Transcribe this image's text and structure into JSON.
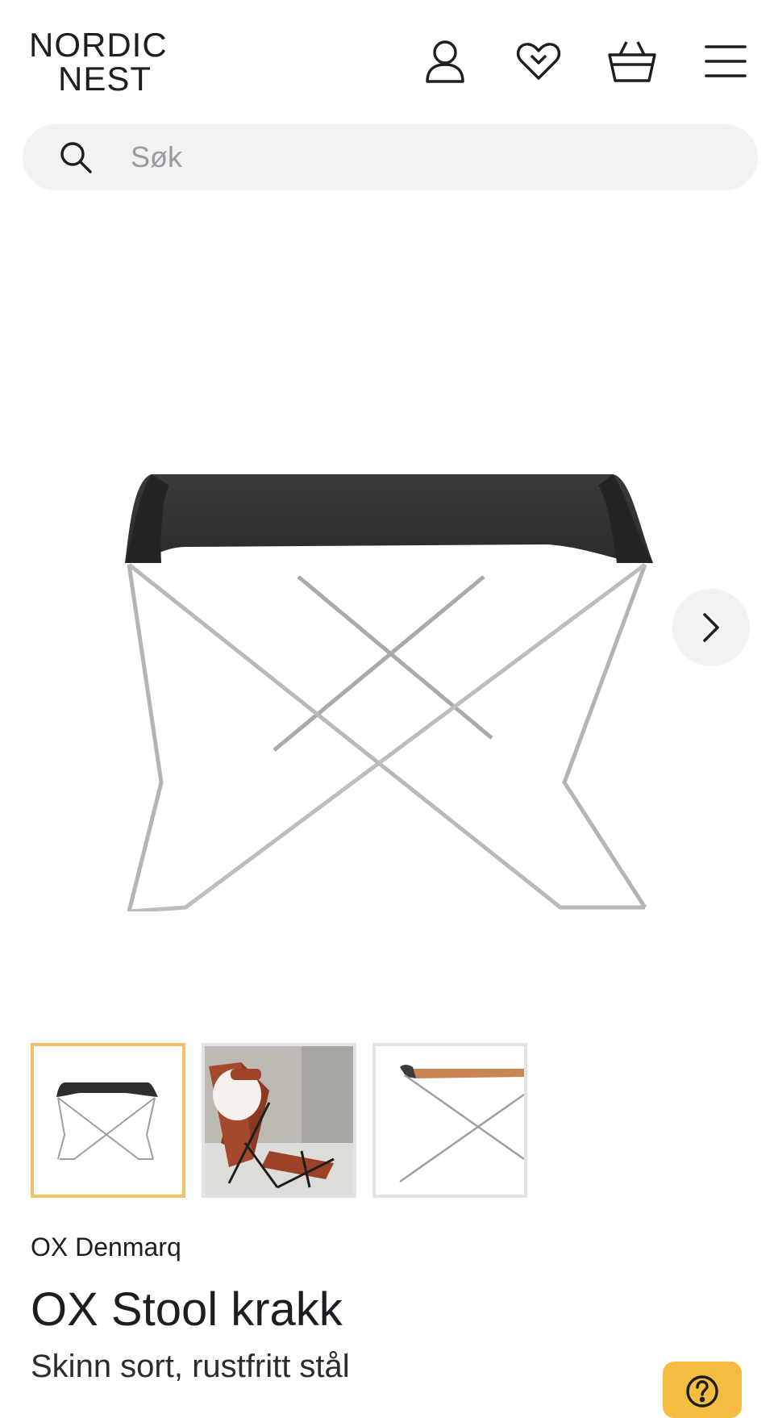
{
  "header": {
    "logo_line1": "NORDIC",
    "logo_line2": "NEST",
    "icons": [
      "account-icon",
      "wishlist-heart-icon",
      "basket-icon",
      "menu-icon"
    ]
  },
  "search": {
    "placeholder": "Søk",
    "value": ""
  },
  "gallery": {
    "images": [
      "stool-black-leather",
      "butterfly-chair-with-stool",
      "stool-cognac-leather-detail"
    ],
    "selected_index": 0,
    "next_icon": "chevron-right-icon"
  },
  "product": {
    "brand": "OX Denmarq",
    "title": "OX Stool krakk",
    "variant": "Skinn sort, rustfritt stål"
  },
  "colors": {
    "accent": "#f5bd3f",
    "thumb_selected_border": "#f0c36a",
    "search_bg": "#f2f2f3",
    "text": "#1d1d22"
  },
  "help_icon": "help-question-icon"
}
